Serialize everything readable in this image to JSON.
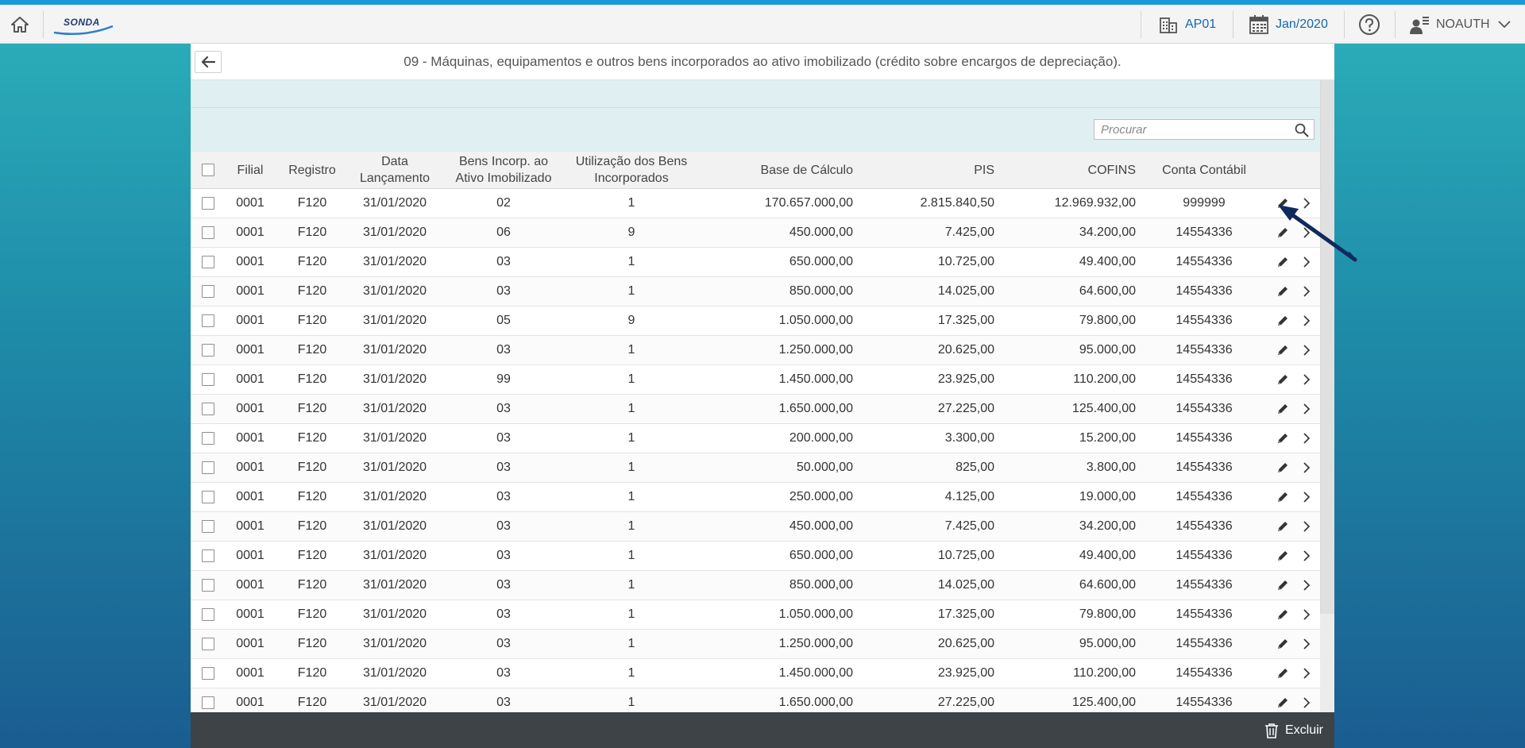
{
  "header": {
    "company": "AP01",
    "period": "Jan/2020",
    "user": "NOAUTH",
    "logo_text": "SONDA"
  },
  "page": {
    "title": "09 - Máquinas, equipamentos e outros bens incorporados ao ativo imobilizado (crédito sobre encargos de depreciação)."
  },
  "search": {
    "placeholder": "Procurar"
  },
  "table": {
    "columns": {
      "filial": "Filial",
      "registro": "Registro",
      "data1": "Data",
      "data2": "Lançamento",
      "bens1": "Bens Incorp. ao",
      "bens2": "Ativo Imobilizado",
      "util1": "Utilização dos Bens",
      "util2": "Incorporados",
      "base": "Base de Cálculo",
      "pis": "PIS",
      "cofins": "COFINS",
      "conta": "Conta Contábil"
    },
    "rows": [
      {
        "filial": "0001",
        "registro": "F120",
        "data": "31/01/2020",
        "bens": "02",
        "util": "1",
        "base": "170.657.000,00",
        "pis": "2.815.840,50",
        "cofins": "12.969.932,00",
        "conta": "999999"
      },
      {
        "filial": "0001",
        "registro": "F120",
        "data": "31/01/2020",
        "bens": "06",
        "util": "9",
        "base": "450.000,00",
        "pis": "7.425,00",
        "cofins": "34.200,00",
        "conta": "14554336"
      },
      {
        "filial": "0001",
        "registro": "F120",
        "data": "31/01/2020",
        "bens": "03",
        "util": "1",
        "base": "650.000,00",
        "pis": "10.725,00",
        "cofins": "49.400,00",
        "conta": "14554336"
      },
      {
        "filial": "0001",
        "registro": "F120",
        "data": "31/01/2020",
        "bens": "03",
        "util": "1",
        "base": "850.000,00",
        "pis": "14.025,00",
        "cofins": "64.600,00",
        "conta": "14554336"
      },
      {
        "filial": "0001",
        "registro": "F120",
        "data": "31/01/2020",
        "bens": "05",
        "util": "9",
        "base": "1.050.000,00",
        "pis": "17.325,00",
        "cofins": "79.800,00",
        "conta": "14554336"
      },
      {
        "filial": "0001",
        "registro": "F120",
        "data": "31/01/2020",
        "bens": "03",
        "util": "1",
        "base": "1.250.000,00",
        "pis": "20.625,00",
        "cofins": "95.000,00",
        "conta": "14554336"
      },
      {
        "filial": "0001",
        "registro": "F120",
        "data": "31/01/2020",
        "bens": "99",
        "util": "1",
        "base": "1.450.000,00",
        "pis": "23.925,00",
        "cofins": "110.200,00",
        "conta": "14554336"
      },
      {
        "filial": "0001",
        "registro": "F120",
        "data": "31/01/2020",
        "bens": "03",
        "util": "1",
        "base": "1.650.000,00",
        "pis": "27.225,00",
        "cofins": "125.400,00",
        "conta": "14554336"
      },
      {
        "filial": "0001",
        "registro": "F120",
        "data": "31/01/2020",
        "bens": "03",
        "util": "1",
        "base": "200.000,00",
        "pis": "3.300,00",
        "cofins": "15.200,00",
        "conta": "14554336"
      },
      {
        "filial": "0001",
        "registro": "F120",
        "data": "31/01/2020",
        "bens": "03",
        "util": "1",
        "base": "50.000,00",
        "pis": "825,00",
        "cofins": "3.800,00",
        "conta": "14554336"
      },
      {
        "filial": "0001",
        "registro": "F120",
        "data": "31/01/2020",
        "bens": "03",
        "util": "1",
        "base": "250.000,00",
        "pis": "4.125,00",
        "cofins": "19.000,00",
        "conta": "14554336"
      },
      {
        "filial": "0001",
        "registro": "F120",
        "data": "31/01/2020",
        "bens": "03",
        "util": "1",
        "base": "450.000,00",
        "pis": "7.425,00",
        "cofins": "34.200,00",
        "conta": "14554336"
      },
      {
        "filial": "0001",
        "registro": "F120",
        "data": "31/01/2020",
        "bens": "03",
        "util": "1",
        "base": "650.000,00",
        "pis": "10.725,00",
        "cofins": "49.400,00",
        "conta": "14554336"
      },
      {
        "filial": "0001",
        "registro": "F120",
        "data": "31/01/2020",
        "bens": "03",
        "util": "1",
        "base": "850.000,00",
        "pis": "14.025,00",
        "cofins": "64.600,00",
        "conta": "14554336"
      },
      {
        "filial": "0001",
        "registro": "F120",
        "data": "31/01/2020",
        "bens": "03",
        "util": "1",
        "base": "1.050.000,00",
        "pis": "17.325,00",
        "cofins": "79.800,00",
        "conta": "14554336"
      },
      {
        "filial": "0001",
        "registro": "F120",
        "data": "31/01/2020",
        "bens": "03",
        "util": "1",
        "base": "1.250.000,00",
        "pis": "20.625,00",
        "cofins": "95.000,00",
        "conta": "14554336"
      },
      {
        "filial": "0001",
        "registro": "F120",
        "data": "31/01/2020",
        "bens": "03",
        "util": "1",
        "base": "1.450.000,00",
        "pis": "23.925,00",
        "cofins": "110.200,00",
        "conta": "14554336"
      },
      {
        "filial": "0001",
        "registro": "F120",
        "data": "31/01/2020",
        "bens": "03",
        "util": "1",
        "base": "1.650.000,00",
        "pis": "27.225,00",
        "cofins": "125.400,00",
        "conta": "14554336"
      }
    ]
  },
  "footer": {
    "delete_label": "Excluir"
  },
  "colors": {
    "accent": "#1a9ad8",
    "link": "#1368b0",
    "footer": "#3d4347",
    "annotation_arrow": "#0f2a5c"
  }
}
